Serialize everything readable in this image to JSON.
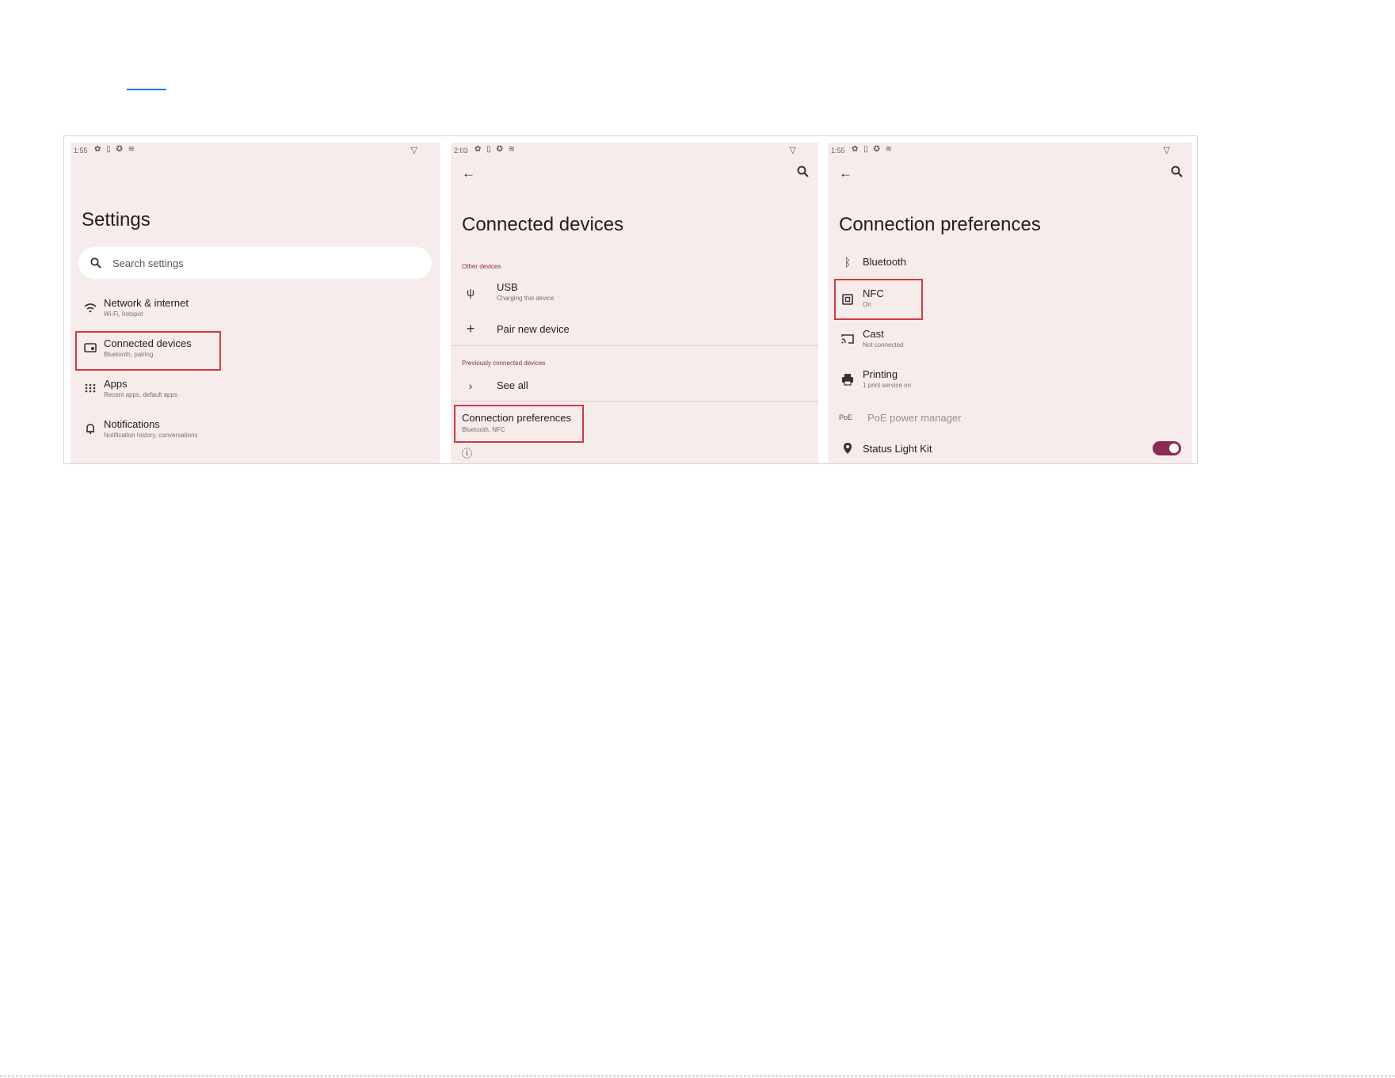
{
  "panel_settings": {
    "status": {
      "time": "1:55"
    },
    "title": "Settings",
    "search_placeholder": "Search settings",
    "items": [
      {
        "title": "Network & internet",
        "subtitle": "Wi-Fi, hotspot",
        "icon": "wifi-icon"
      },
      {
        "title": "Connected devices",
        "subtitle": "Bluetooth, pairing",
        "icon": "connected-devices-icon"
      },
      {
        "title": "Apps",
        "subtitle": "Recent apps, default apps",
        "icon": "apps-grid-icon"
      },
      {
        "title": "Notifications",
        "subtitle": "Notification history, conversations",
        "icon": "bell-icon"
      }
    ]
  },
  "panel_connected": {
    "status": {
      "time": "2:03"
    },
    "title": "Connected devices",
    "section_other": "Other devices",
    "usb": {
      "title": "USB",
      "subtitle": "Charging this device"
    },
    "pair": {
      "title": "Pair new device"
    },
    "section_previous": "Previously connected devices",
    "see_all": {
      "title": "See all"
    },
    "conn_prefs": {
      "title": "Connection preferences",
      "subtitle": "Bluetooth, NFC"
    }
  },
  "panel_prefs": {
    "status": {
      "time": "1:55"
    },
    "title": "Connection preferences",
    "bluetooth": {
      "title": "Bluetooth"
    },
    "nfc": {
      "title": "NFC",
      "subtitle": "On"
    },
    "cast": {
      "title": "Cast",
      "subtitle": "Not connected"
    },
    "printing": {
      "title": "Printing",
      "subtitle": "1 print service on"
    },
    "poe": {
      "label": "PoE",
      "title": "PoE power manager"
    },
    "status_light": {
      "title": "Status Light Kit",
      "toggle_on": true
    }
  },
  "colors": {
    "accent": "#8c2c52",
    "highlight": "#d23a45",
    "panel_bg": "#f7ecec"
  }
}
